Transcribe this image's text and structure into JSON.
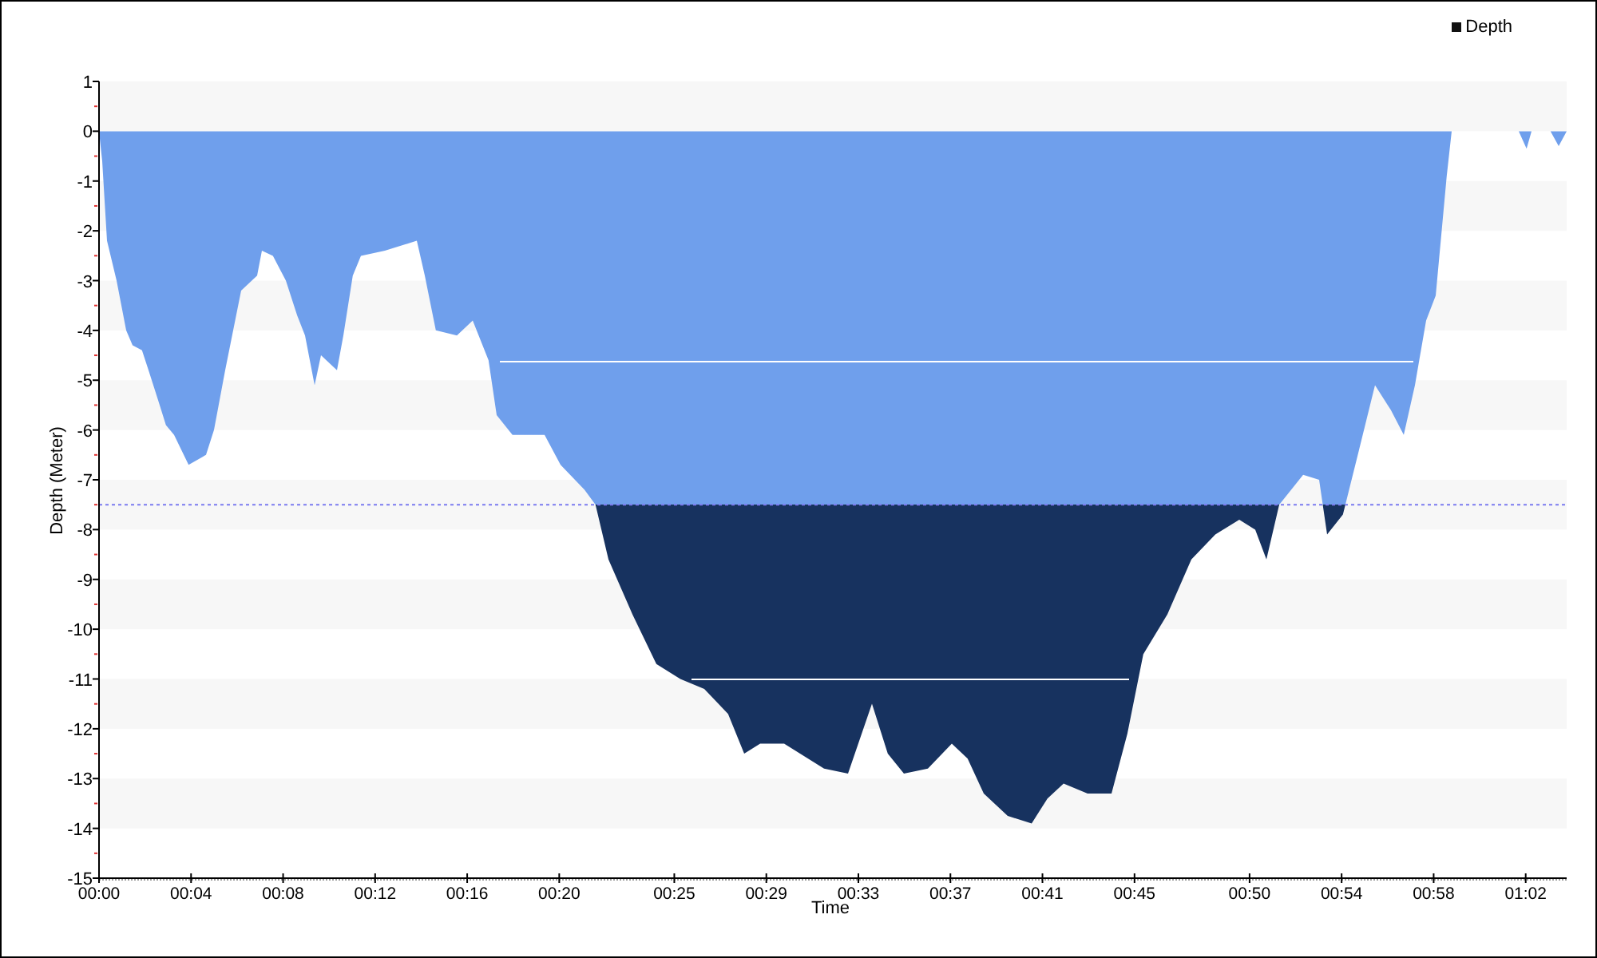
{
  "chart_data": {
    "type": "area",
    "xlabel": "Time",
    "ylabel": "Depth (Meter)",
    "xlim": [
      0,
      63.78
    ],
    "ylim": [
      -15,
      1
    ],
    "x": [
      0,
      0.14,
      0.35,
      0.76,
      1.18,
      1.46,
      1.87,
      2.15,
      2.57,
      2.91,
      3.26,
      3.89,
      4.65,
      5.0,
      5.48,
      6.18,
      6.87,
      7.08,
      7.56,
      8.12,
      8.61,
      8.95,
      9.37,
      9.65,
      10.34,
      10.62,
      11.03,
      11.38,
      12.42,
      13.81,
      14.16,
      14.64,
      15.55,
      16.24,
      16.93,
      17.28,
      17.97,
      19.36,
      20.06,
      21.1,
      21.58,
      22.14,
      23.18,
      24.22,
      25.26,
      26.3,
      27.34,
      28.04,
      28.73,
      29.77,
      30.47,
      31.51,
      32.55,
      33.59,
      34.28,
      34.98,
      36.02,
      37.06,
      37.75,
      38.45,
      39.49,
      40.53,
      41.22,
      41.92,
      42.96,
      44.0,
      44.69,
      45.38,
      46.43,
      47.47,
      48.51,
      49.55,
      50.25,
      50.73,
      51.29,
      52.33,
      53.02,
      53.37,
      54.06,
      54.76,
      55.45,
      56.14,
      56.7,
      57.19,
      57.67,
      58.09,
      58.57,
      58.78,
      61.7,
      62.04,
      62.25,
      63.08,
      63.43,
      63.78
    ],
    "series": [
      {
        "name": "Depth",
        "color": "#6f9fec",
        "values": [
          0,
          -0.6,
          -2.2,
          -3,
          -4,
          -4.3,
          -4.4,
          -4.8,
          -5.4,
          -5.9,
          -6.1,
          -6.7,
          -6.5,
          -6,
          -4.8,
          -3.2,
          -2.9,
          -2.4,
          -2.5,
          -3,
          -3.7,
          -4.1,
          -5.1,
          -4.5,
          -4.8,
          -4.1,
          -2.9,
          -2.5,
          -2.4,
          -2.2,
          -2.9,
          -4,
          -4.1,
          -3.8,
          -4.6,
          -5.7,
          -6.1,
          -6.1,
          -6.7,
          -7.2,
          -7.5,
          -8.6,
          -9.7,
          -10.7,
          -11,
          -11.2,
          -11.7,
          -12.5,
          -12.3,
          -12.3,
          -12.5,
          -12.8,
          -12.9,
          -11.5,
          -12.5,
          -12.9,
          -12.8,
          -12.3,
          -12.6,
          -13.3,
          -13.75,
          -13.9,
          -13.4,
          -13.1,
          -13.3,
          -13.3,
          -12.1,
          -10.5,
          -9.7,
          -8.6,
          -8.1,
          -7.8,
          -8,
          -8.6,
          -7.5,
          -6.9,
          -7,
          -8.1,
          -7.7,
          -6.4,
          -5.1,
          -5.6,
          -6.1,
          -5.1,
          -3.8,
          -3.3,
          -0.9,
          0,
          0,
          -0.35,
          0,
          0,
          -0.3,
          0
        ]
      }
    ],
    "xticks": [
      {
        "value": 0,
        "label": "00:00"
      },
      {
        "value": 4,
        "label": "00:04"
      },
      {
        "value": 8,
        "label": "00:08"
      },
      {
        "value": 12,
        "label": "00:12"
      },
      {
        "value": 16,
        "label": "00:16"
      },
      {
        "value": 20,
        "label": "00:20"
      },
      {
        "value": 25,
        "label": "00:25"
      },
      {
        "value": 29,
        "label": "00:29"
      },
      {
        "value": 33,
        "label": "00:33"
      },
      {
        "value": 37,
        "label": "00:37"
      },
      {
        "value": 41,
        "label": "00:41"
      },
      {
        "value": 45,
        "label": "00:45"
      },
      {
        "value": 50,
        "label": "00:50"
      },
      {
        "value": 54,
        "label": "00:54"
      },
      {
        "value": 58,
        "label": "00:58"
      },
      {
        "value": 62,
        "label": "01:02"
      }
    ],
    "yticks": [
      1,
      0,
      -1,
      -2,
      -3,
      -4,
      -5,
      -6,
      -7,
      -8,
      -9,
      -10,
      -11,
      -12,
      -13,
      -14,
      -15
    ],
    "ref_lines": [
      {
        "axis": "y",
        "value": -7.5
      },
      {
        "axis": "y",
        "value": -4.6
      }
    ]
  }
}
